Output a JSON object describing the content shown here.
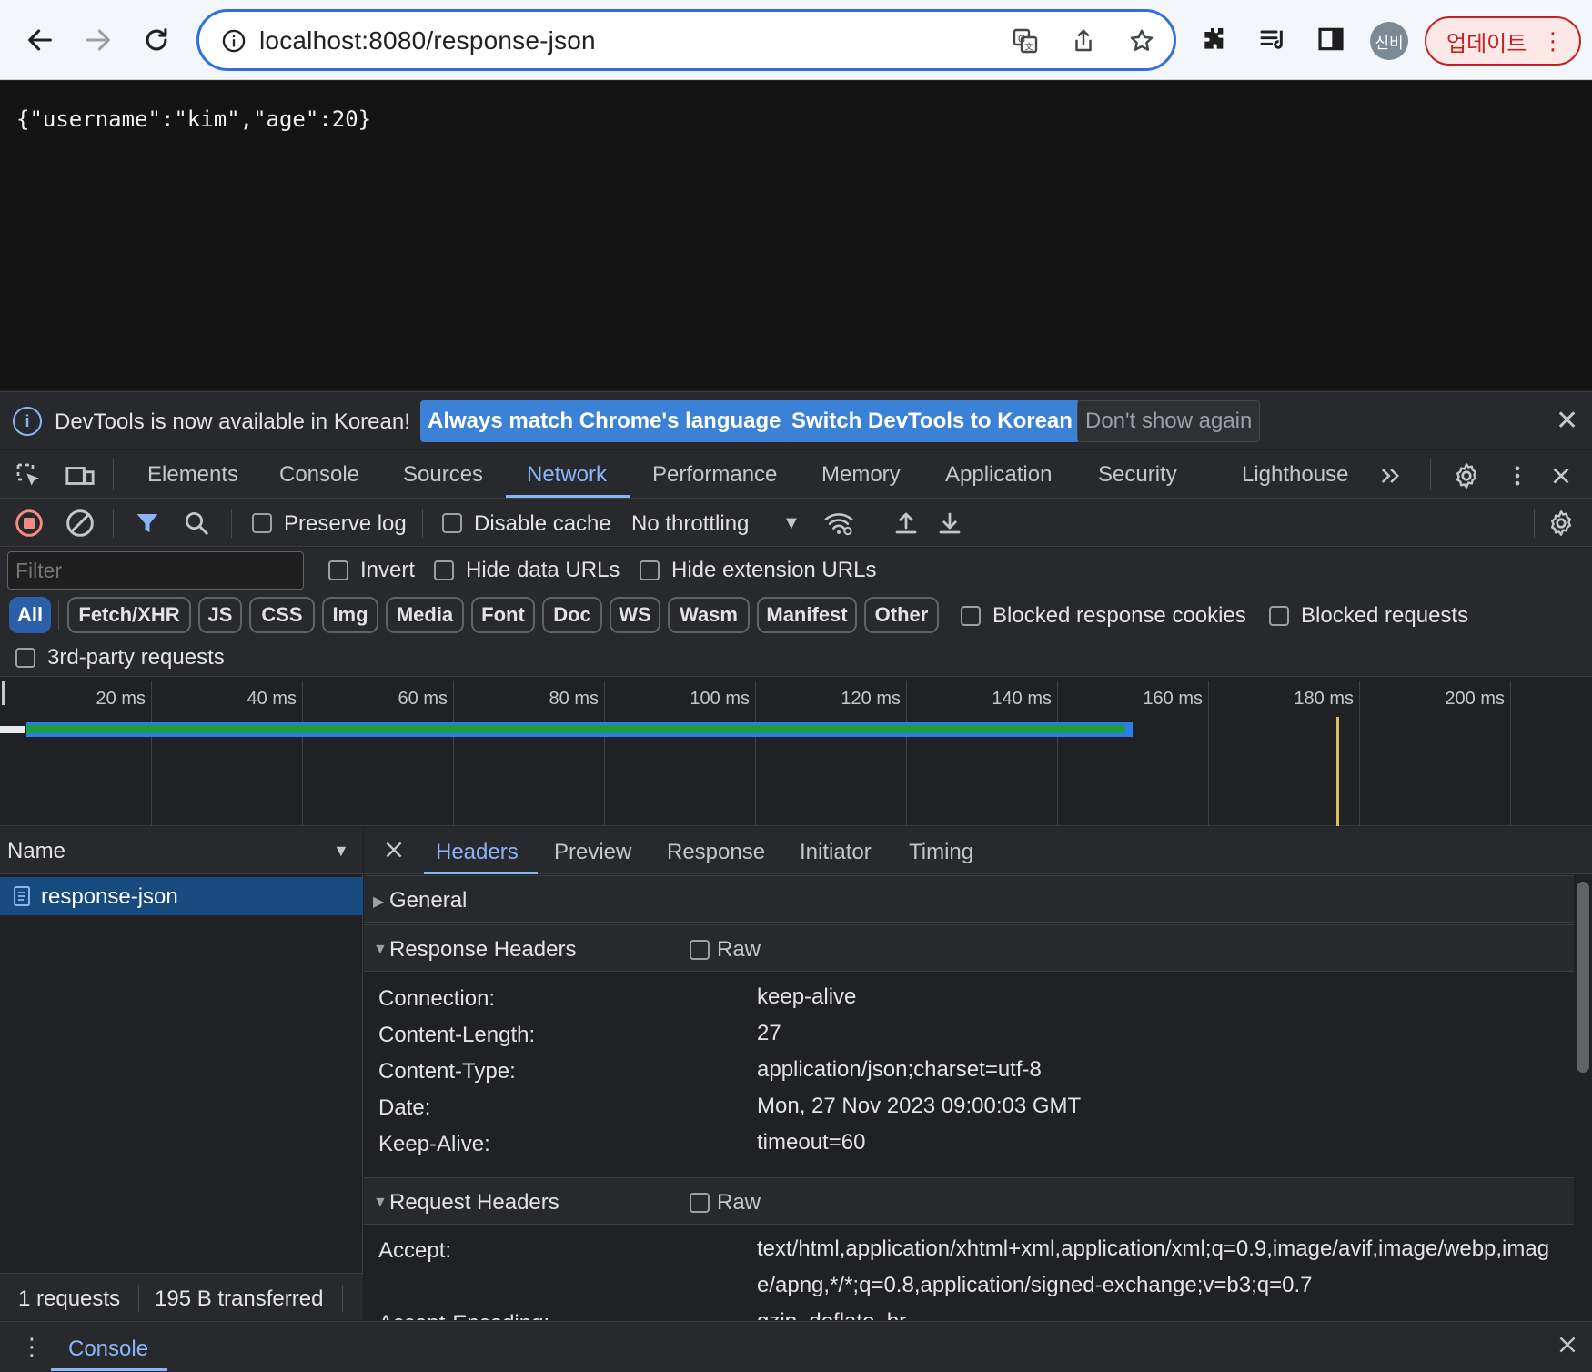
{
  "browser": {
    "url": "localhost:8080/response-json",
    "avatar_text": "신비",
    "update_label": "업데이트"
  },
  "page": {
    "body_text": "{\"username\":\"kim\",\"age\":20}"
  },
  "infobar": {
    "message": "DevTools is now available in Korean!",
    "btn_match": "Always match Chrome's language",
    "btn_switch": "Switch DevTools to Korean",
    "btn_dismiss": "Don't show again"
  },
  "devtools_tabs": [
    "Elements",
    "Console",
    "Sources",
    "Network",
    "Performance",
    "Memory",
    "Application",
    "Security",
    "Lighthouse"
  ],
  "network_toolbar": {
    "preserve_log": "Preserve log",
    "disable_cache": "Disable cache",
    "throttling": "No throttling"
  },
  "filter": {
    "placeholder": "Filter",
    "invert": "Invert",
    "hide_data_urls": "Hide data URLs",
    "hide_extension_urls": "Hide extension URLs",
    "types": [
      "All",
      "Fetch/XHR",
      "JS",
      "CSS",
      "Img",
      "Media",
      "Font",
      "Doc",
      "WS",
      "Wasm",
      "Manifest",
      "Other"
    ],
    "blocked_cookies": "Blocked response cookies",
    "blocked_requests": "Blocked requests",
    "third_party": "3rd-party requests"
  },
  "timeline": {
    "ticks": [
      "20 ms",
      "40 ms",
      "60 ms",
      "80 ms",
      "100 ms",
      "120 ms",
      "140 ms",
      "160 ms",
      "180 ms",
      "200 ms"
    ],
    "max_ms": 220,
    "request_start_ms": 3.5,
    "request_end_ms": 150,
    "load_marker_ms": 177,
    "colors": {
      "waiting": "#1a9e3e",
      "receiving": "#2b7de9",
      "load_marker": "#ddbe55"
    }
  },
  "requests": {
    "name_header": "Name",
    "items": [
      "response-json"
    ],
    "count": "1 requests",
    "transferred": "195 B transferred"
  },
  "details": {
    "tabs": [
      "Headers",
      "Preview",
      "Response",
      "Initiator",
      "Timing"
    ],
    "general": "General",
    "response_headers_title": "Response Headers",
    "request_headers_title": "Request Headers",
    "raw_label": "Raw",
    "response_headers": [
      {
        "name": "Connection:",
        "value": "keep-alive"
      },
      {
        "name": "Content-Length:",
        "value": "27"
      },
      {
        "name": "Content-Type:",
        "value": "application/json;charset=utf-8"
      },
      {
        "name": "Date:",
        "value": "Mon, 27 Nov 2023 09:00:03 GMT"
      },
      {
        "name": "Keep-Alive:",
        "value": "timeout=60"
      }
    ],
    "request_headers": [
      {
        "name": "Accept:",
        "value": "text/html,application/xhtml+xml,application/xml;q=0.9,image/avif,image/webp,image/apng,*/*;q=0.8,application/signed-exchange;v=b3;q=0.7"
      },
      {
        "name": "Accept-Encoding:",
        "value": "gzip, deflate, br"
      }
    ]
  },
  "drawer": {
    "console_label": "Console"
  },
  "colors": {
    "accent": "#8ab4f8",
    "omnibox_border": "#2f6fe0",
    "update_red": "#c5221f"
  }
}
